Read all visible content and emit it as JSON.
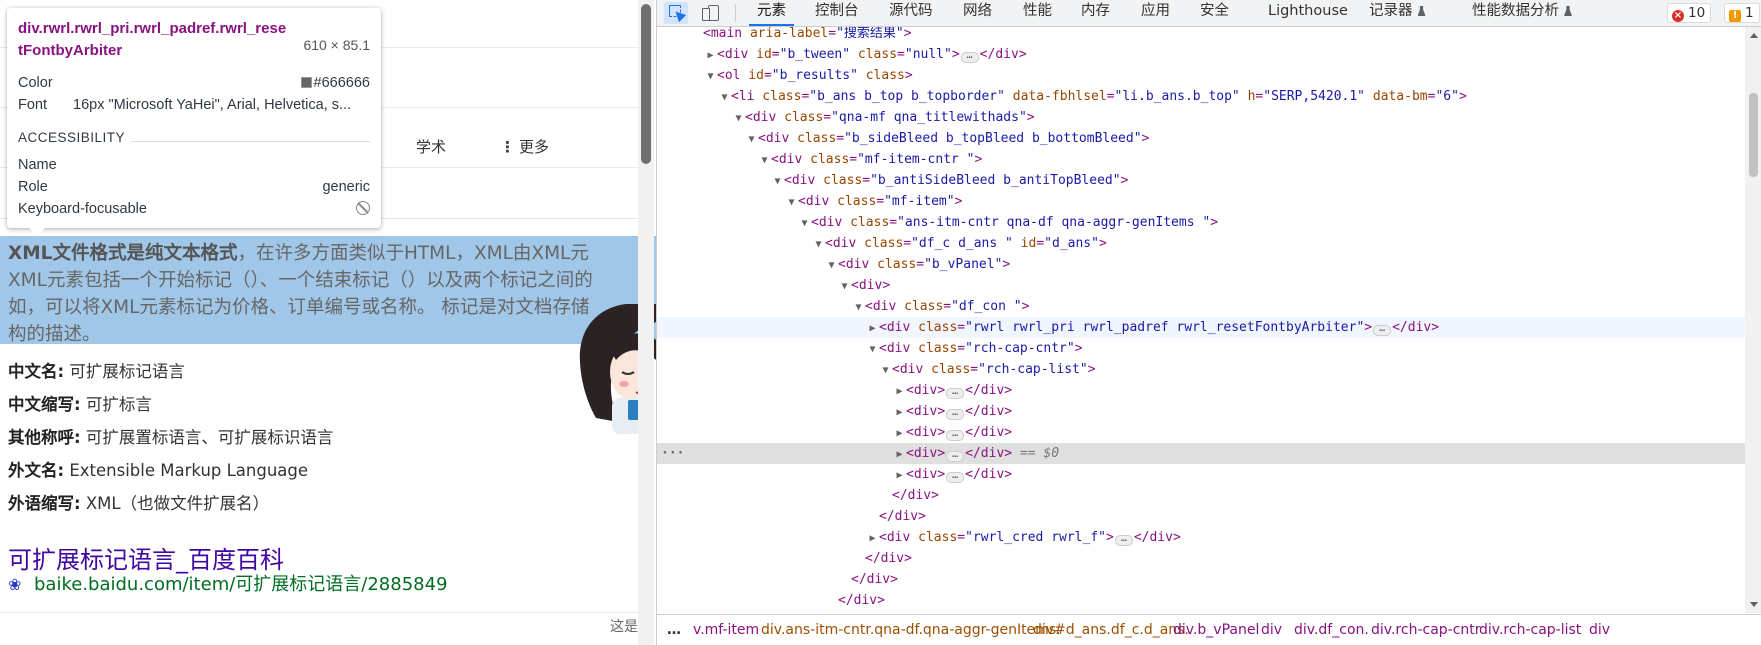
{
  "page": {
    "scope_tabs": [
      "学术",
      "更多"
    ],
    "answer": {
      "bold_lead": "XML文件格式是纯文本格式",
      "line1_rest": "，在许多方面类似于HTML，XML由XML元",
      "line2": "XML元素包括一个开始标记（）、一个结束标记（）以及两个标记之间的",
      "line3": "如，可以将XML元素标记为价格、订单编号或名称。 标记是对文档存储",
      "line4": "构的描述。"
    },
    "facts": [
      {
        "key": "中文名:",
        "value": "可扩展标记语言"
      },
      {
        "key": "中文缩写:",
        "value": "可扩标言"
      },
      {
        "key": "其他称呼:",
        "value": "可扩展置标语言、可扩展标识语言"
      },
      {
        "key": "外文名:",
        "value": "Extensible Markup Language"
      },
      {
        "key": "外语缩写:",
        "value": "XML（也做文件扩展名）"
      }
    ],
    "source_title": "可扩展标记语言_百度百科",
    "source_url": "baike.baidu.com/item/可扩展标记语言/2885849",
    "footer_cut": "这是"
  },
  "tooltip": {
    "selector": "div.rwrl.rwrl_pri.rwrl_padref.rwrl_resetFontbyArbiter",
    "size": "610 × 85.1",
    "color_label": "Color",
    "color_value": "#666666",
    "font_label": "Font",
    "font_value": "16px \"Microsoft YaHei\", Arial, Helvetica, s...",
    "section": "ACCESSIBILITY",
    "name_label": "Name",
    "name_value": "",
    "role_label": "Role",
    "role_value": "generic",
    "kbd_label": "Keyboard-focusable"
  },
  "devtools": {
    "tabs": [
      "元素",
      "控制台",
      "源代码",
      "网络",
      "性能",
      "内存",
      "应用",
      "安全",
      "Lighthouse",
      "记录器",
      "性能数据分析"
    ],
    "active_tab": "元素",
    "errors": "10",
    "warnings": "1",
    "dom": [
      {
        "t": "",
        "h": "<main aria-label=\"搜索结果\">"
      },
      {
        "t": "▶",
        "h": "<div id=\"b_tween\" class=\"null\">…</div>"
      },
      {
        "t": "▼",
        "h": "<ol id=\"b_results\" class>"
      },
      {
        "t": "▼",
        "h": "<li class=\"b_ans b_top b_topborder\" data-fbhlsel=\"li.b_ans.b_top\" h=\"SERP,5420.1\" data-bm=\"6\">"
      },
      {
        "t": "▼",
        "h": "<div class=\"qna-mf qna_titlewithads\">"
      },
      {
        "t": "▼",
        "h": "<div class=\"b_sideBleed b_topBleed b_bottomBleed\">"
      },
      {
        "t": "▼",
        "h": "<div class=\"mf-item-cntr \">"
      },
      {
        "t": "▼",
        "h": "<div class=\"b_antiSideBleed b_antiTopBleed\">"
      },
      {
        "t": "▼",
        "h": "<div class=\"mf-item\">"
      },
      {
        "t": "▼",
        "h": "<div class=\"ans-itm-cntr qna-df qna-aggr-genItems \">"
      },
      {
        "t": "▼",
        "h": "<div class=\"df_c d_ans \" id=\"d_ans\">"
      },
      {
        "t": "▼",
        "h": "<div class=\"b_vPanel\">"
      },
      {
        "t": "▼",
        "h": "<div>"
      },
      {
        "t": "▼",
        "h": "<div class=\"df_con \">"
      },
      {
        "t": "▶",
        "h": "<div class=\"rwrl rwrl_pri rwrl_padref rwrl_resetFontbyArbiter\">…</div>"
      },
      {
        "t": "▼",
        "h": "<div class=\"rch-cap-cntr\">"
      },
      {
        "t": "▼",
        "h": "<div class=\"rch-cap-list\">"
      },
      {
        "t": "▶",
        "h": "<div>…</div>"
      },
      {
        "t": "▶",
        "h": "<div>…</div>"
      },
      {
        "t": "▶",
        "h": "<div>…</div>"
      },
      {
        "t": "▶",
        "h": "<div>…</div>",
        "eq": "== $0"
      },
      {
        "t": "▶",
        "h": "<div>…</div>"
      },
      {
        "t": "",
        "h": "</div>"
      },
      {
        "t": "",
        "h": "</div>"
      },
      {
        "t": "▶",
        "h": "<div class=\"rwrl_cred rwrl_f\">…</div>"
      },
      {
        "t": "",
        "h": "</div>"
      },
      {
        "t": "",
        "h": "</div>"
      },
      {
        "t": "",
        "h": "</div>"
      }
    ],
    "breadcrumbs": [
      "…",
      "v.mf-item",
      "div.ans-itm-cntr.qna-df.qna-aggr-genItems.",
      "div#d_ans.df_c.d_ans.",
      "div.b_vPanel",
      "div",
      "div.df_con.",
      "div.rch-cap-cntr",
      "div.rch-cap-list",
      "div"
    ]
  },
  "colors": {
    "selection_highlight": "#6fa8dc",
    "devtools_accent": "#1a73e8",
    "tag": "#881280",
    "attr": "#994500",
    "value": "#1a1aa6",
    "link": "#4007a2",
    "url": "#006d21"
  }
}
